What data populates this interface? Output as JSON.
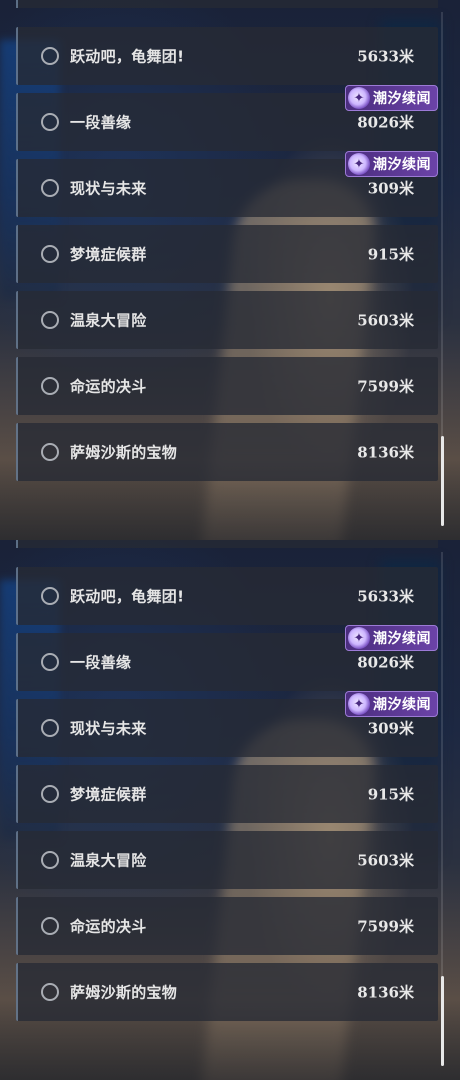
{
  "badge_label": "潮汐续闻",
  "badge_icon": "tide-logo-icon",
  "colors": {
    "row_bg": "#262a34",
    "accent_border": "#8caac8",
    "badge_bg": "#5b3a95",
    "text": "#e6e6e6"
  },
  "panels": [
    {
      "items": [
        {
          "name": "跃动吧，龟舞团!",
          "distance": "5633米",
          "badge": false
        },
        {
          "name": "一段善缘",
          "distance": "8026米",
          "badge": true
        },
        {
          "name": "现状与未来",
          "distance": "309米",
          "badge": true
        },
        {
          "name": "梦境症候群",
          "distance": "915米",
          "badge": false
        },
        {
          "name": "温泉大冒险",
          "distance": "5603米",
          "badge": false
        },
        {
          "name": "命运的决斗",
          "distance": "7599米",
          "badge": false
        },
        {
          "name": "萨姆沙斯的宝物",
          "distance": "8136米",
          "badge": false
        }
      ]
    },
    {
      "items": [
        {
          "name": "跃动吧，龟舞团!",
          "distance": "5633米",
          "badge": false
        },
        {
          "name": "一段善缘",
          "distance": "8026米",
          "badge": true
        },
        {
          "name": "现状与未来",
          "distance": "309米",
          "badge": true
        },
        {
          "name": "梦境症候群",
          "distance": "915米",
          "badge": false
        },
        {
          "name": "温泉大冒险",
          "distance": "5603米",
          "badge": false
        },
        {
          "name": "命运的决斗",
          "distance": "7599米",
          "badge": false
        },
        {
          "name": "萨姆沙斯的宝物",
          "distance": "8136米",
          "badge": false
        }
      ]
    }
  ]
}
